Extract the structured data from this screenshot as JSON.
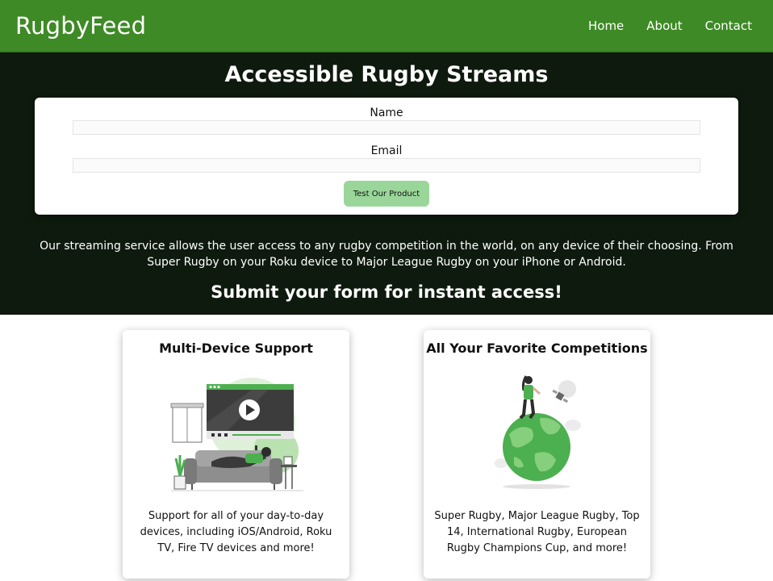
{
  "header": {
    "brand": "RugbyFeed",
    "nav": [
      "Home",
      "About",
      "Contact"
    ]
  },
  "hero": {
    "title": "Accessible Rugby Streams",
    "form": {
      "name_label": "Name",
      "name_value": "",
      "email_label": "Email",
      "email_value": "",
      "submit_label": "Test Our Product"
    },
    "description": "Our streaming service allows the user access to any rugby competition in the world, on any device of their choosing. From Super Rugby on your Roku device to Major League Rugby on your iPhone or Android.",
    "cta": "Submit your form for instant access!"
  },
  "features": [
    {
      "title": "Multi-Device Support",
      "text": "Support for all of your day-to-day devices, including iOS/Android, Roku TV, Fire TV devices and more!",
      "illustration": "person-watching-tv-illustration"
    },
    {
      "title": "All Your Favorite Competitions",
      "text": "Super Rugby, Major League Rugby, Top 14, International Rugby, European Rugby Champions Cup, and more!",
      "illustration": "person-on-globe-illustration"
    }
  ],
  "colors": {
    "nav_bg": "#3e8a26",
    "hero_bg": "#0e1a0e",
    "button_bg": "#9ad69a",
    "accent_green": "#4caf50"
  }
}
